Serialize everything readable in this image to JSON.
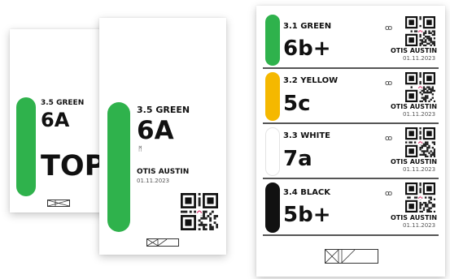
{
  "card_back": {
    "grade_label": "3.5 GREEN",
    "grade": "6A",
    "top_label": "TOP",
    "color": "#2fb24c"
  },
  "card_mid": {
    "grade_label": "3.5 GREEN",
    "grade": "6A",
    "setter": "OTIS AUSTIN",
    "date": "01.11.2023",
    "color": "#2fb24c"
  },
  "card_right": {
    "rows": [
      {
        "grade_label": "3.1 GREEN",
        "grade": "6b+",
        "setter": "OTIS AUSTIN",
        "date": "01.11.2023",
        "color": "#2fb24c"
      },
      {
        "grade_label": "3.2 YELLOW",
        "grade": "5c",
        "setter": "OTIS AUSTIN",
        "date": "01.11.2023",
        "color": "#f5b800"
      },
      {
        "grade_label": "3.3 WHITE",
        "grade": "7a",
        "setter": "OTIS AUSTIN",
        "date": "01.11.2023",
        "color": "#ffffff"
      },
      {
        "grade_label": "3.4 BLACK",
        "grade": "5b+",
        "setter": "OTIS AUSTIN",
        "date": "01.11.2023",
        "color": "#111111"
      }
    ]
  }
}
